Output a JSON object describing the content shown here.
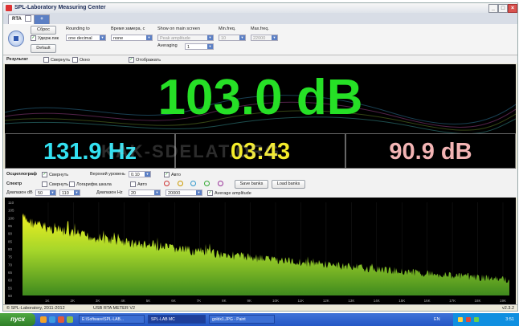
{
  "window": {
    "title": "SPL-Laboratory Measuring Center"
  },
  "tabs": [
    {
      "label": "RTA"
    },
    {
      "label": "+"
    }
  ],
  "toolbar": {
    "reset_label": "Сброс",
    "hold_peak_label": "Удерж.пик",
    "default_label": "Default",
    "rounding_label": "Rounding to",
    "rounding_value": "one decimal",
    "time_label": "Время замера, с",
    "time_value": "none",
    "show_main_label": "Show on main screen",
    "show_main_value": "Peak amplitude",
    "averaging_label": "Averaging",
    "averaging_value": "1",
    "min_freq_label": "Min.freq.",
    "min_freq_value": "10",
    "max_freq_label": "Max.freq.",
    "max_freq_value": "22000"
  },
  "result_bar": {
    "title": "Результат",
    "collapse_label": "Свернуть",
    "window_label": "Окно",
    "display_label": "Отображать"
  },
  "display": {
    "main_value": "103.0 dB",
    "frequency": "131.9 Hz",
    "time": "03:43",
    "secondary_value": "90.9 dB",
    "colors": {
      "main": "#26e026",
      "frequency": "#33e0f0",
      "time": "#f4ec2a",
      "secondary": "#f3b4b4"
    }
  },
  "oscillograph": {
    "title": "Осциллограф",
    "collapse_label": "Свернуть",
    "upper_level_label": "Верхний уровень",
    "upper_level_value": "0.10",
    "auto_label": "Авто"
  },
  "spectrum_opts": {
    "title": "Спектр",
    "collapse_label": "Свернуть",
    "log_scale_label": "Логарифм.шкала",
    "auto_label": "Авто",
    "save_banks_label": "Save banks",
    "load_banks_label": "Load banks",
    "db_range_label": "Диапазон dB",
    "db_min": "50",
    "db_max": "110",
    "hz_range_label": "Диапазон Hz",
    "hz_min": "20",
    "hz_max": "20000",
    "average_amplitude_label": "Average amplitude"
  },
  "spectrum_chart": {
    "y_ticks": [
      "110",
      "105",
      "100",
      "95",
      "90",
      "85",
      "80",
      "75",
      "70",
      "65",
      "60",
      "55",
      "50"
    ],
    "x_ticks": [
      "1K",
      "2K",
      "3K",
      "4K",
      "5K",
      "6K",
      "7K",
      "8K",
      "9K",
      "10K",
      "11K",
      "12K",
      "13K",
      "14K",
      "15K",
      "16K",
      "17K",
      "18K",
      "19K"
    ],
    "y_range": [
      50,
      110
    ],
    "x_range_hz": [
      20,
      20000
    ]
  },
  "statusbar": {
    "copyright": "© SPL-Laboratory, 2011-2012",
    "device": "USB RTA METER V2",
    "version": "v2.3.2"
  },
  "taskbar": {
    "start_label": "пуск",
    "tasks": [
      {
        "label": "E:\\Software\\SPL-LAB..."
      },
      {
        "label": "SPL-LAB MC"
      },
      {
        "label": "goldx1.JPG - Paint"
      }
    ],
    "language": "EN",
    "clock": "3:51"
  },
  "watermark": "KAK-SDELAT.ORG"
}
